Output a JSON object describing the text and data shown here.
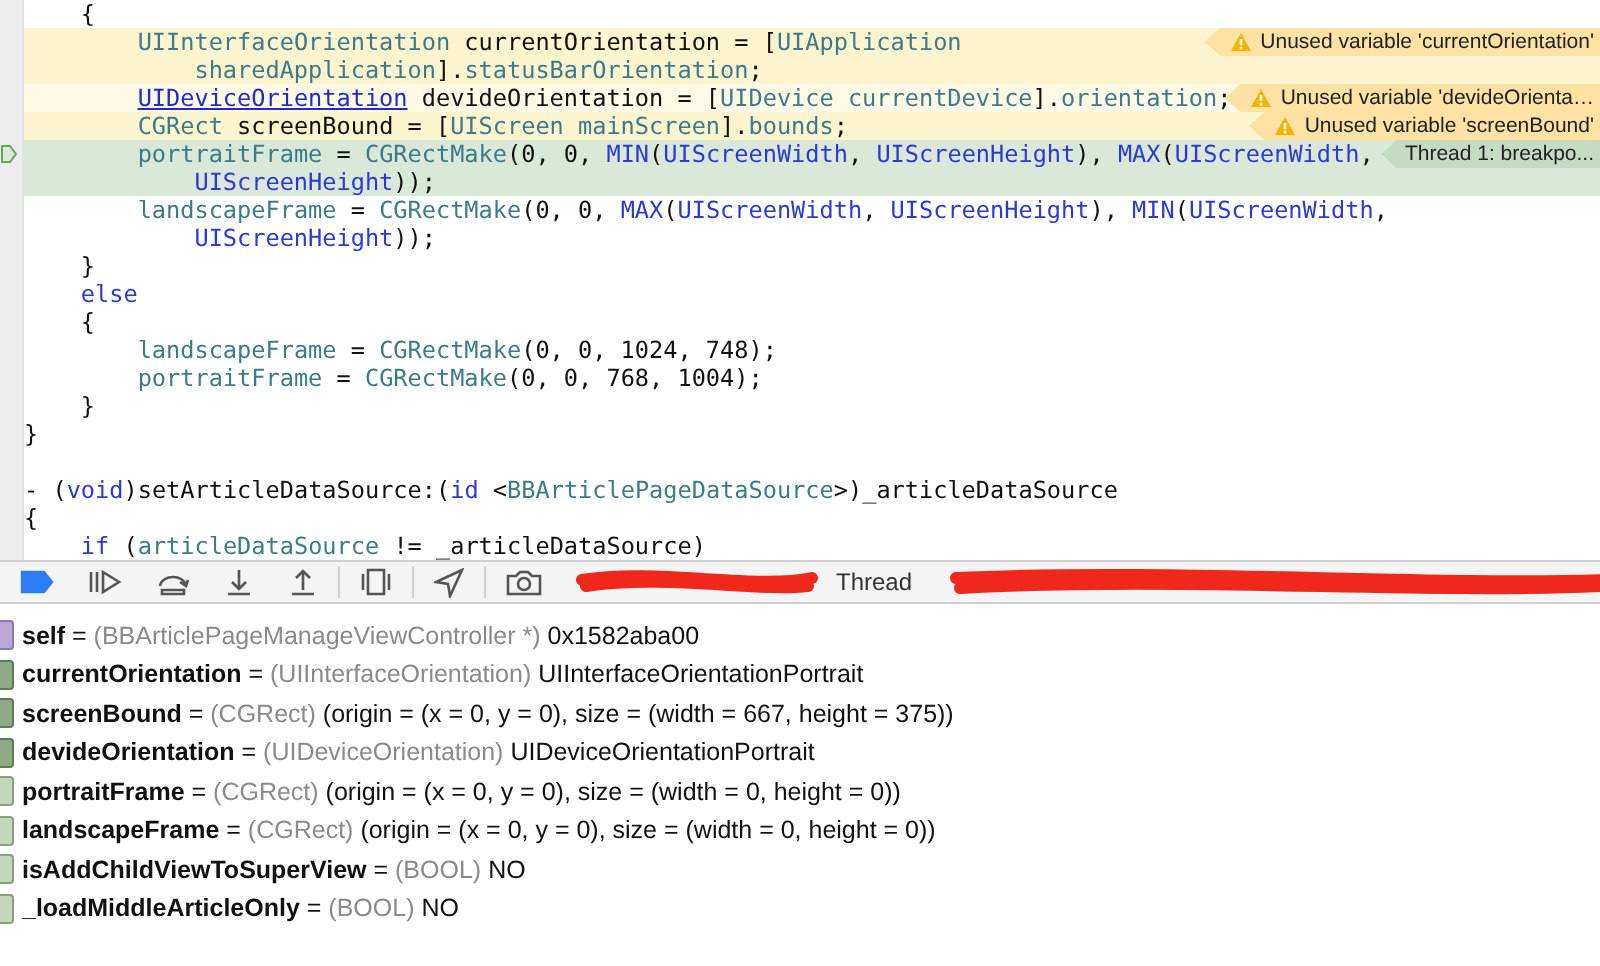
{
  "editor": {
    "lines": [
      {
        "children": [
          {
            "tokens": [
              {
                "kind": "plain",
                "text": "{"
              }
            ],
            "children": [
              {
                "warning": true,
                "tokens": [
                  {
                    "kind": "type",
                    "text": "UIInterfaceOrientation"
                  },
                  {
                    "kind": "plain",
                    "text": " currentOrientation = ["
                  },
                  {
                    "kind": "type",
                    "text": "UIApplication"
                  }
                ],
                "continuation": [
                  {
                    "kind": "type",
                    "text": "sharedApplication"
                  },
                  {
                    "kind": "plain",
                    "text": "]."
                  },
                  {
                    "kind": "type",
                    "text": "statusBarOrientation"
                  },
                  {
                    "kind": "plain",
                    "text": ";"
                  }
                ],
                "annotation": {
                  "kind": "warning",
                  "text": "Unused variable 'currentOrientation'"
                }
              },
              {
                "warning": true,
                "cursor_line": true,
                "tokens": [
                  {
                    "kind": "link",
                    "text": "UIDeviceOrientation"
                  },
                  {
                    "kind": "plain",
                    "text": " devideOrientation = ["
                  },
                  {
                    "kind": "type",
                    "text": "UIDevice currentDevice"
                  },
                  {
                    "kind": "plain",
                    "text": "]."
                  },
                  {
                    "kind": "type",
                    "text": "orientation"
                  },
                  {
                    "kind": "plain",
                    "text": ";"
                  }
                ],
                "annotation": {
                  "kind": "warning",
                  "text": "Unused variable 'devideOrienta…"
                }
              },
              {
                "warning": true,
                "tokens": [
                  {
                    "kind": "type",
                    "text": "CGRect"
                  },
                  {
                    "kind": "plain",
                    "text": " screenBound = ["
                  },
                  {
                    "kind": "type",
                    "text": "UIScreen mainScreen"
                  },
                  {
                    "kind": "plain",
                    "text": "]."
                  },
                  {
                    "kind": "type",
                    "text": "bounds"
                  },
                  {
                    "kind": "plain",
                    "text": ";"
                  }
                ],
                "annotation": {
                  "kind": "warning",
                  "text": "Unused variable 'screenBound'"
                }
              },
              {
                "stopped": true,
                "pc": true,
                "tokens": [
                  {
                    "kind": "type",
                    "text": "portraitFrame"
                  },
                  {
                    "kind": "plain",
                    "text": " = "
                  },
                  {
                    "kind": "type",
                    "text": "CGRectMake"
                  },
                  {
                    "kind": "plain",
                    "text": "(0, 0, "
                  },
                  {
                    "kind": "macro",
                    "text": "MIN"
                  },
                  {
                    "kind": "plain",
                    "text": "("
                  },
                  {
                    "kind": "macro",
                    "text": "UIScreenWidth"
                  },
                  {
                    "kind": "plain",
                    "text": ", "
                  },
                  {
                    "kind": "macro",
                    "text": "UIScreenHeight"
                  },
                  {
                    "kind": "plain",
                    "text": "), "
                  },
                  {
                    "kind": "macro",
                    "text": "MAX"
                  },
                  {
                    "kind": "plain",
                    "text": "("
                  },
                  {
                    "kind": "macro",
                    "text": "UIScreenWidth"
                  },
                  {
                    "kind": "plain",
                    "text": ","
                  }
                ],
                "continuation": [
                  {
                    "kind": "macro",
                    "text": "UIScreenHeight"
                  },
                  {
                    "kind": "plain",
                    "text": "));"
                  }
                ],
                "annotation": {
                  "kind": "thread",
                  "text": "Thread 1: breakpo..."
                }
              },
              {
                "tokens": [
                  {
                    "kind": "type",
                    "text": "landscapeFrame"
                  },
                  {
                    "kind": "plain",
                    "text": " = "
                  },
                  {
                    "kind": "type",
                    "text": "CGRectMake"
                  },
                  {
                    "kind": "plain",
                    "text": "(0, 0, "
                  },
                  {
                    "kind": "macro",
                    "text": "MAX"
                  },
                  {
                    "kind": "plain",
                    "text": "("
                  },
                  {
                    "kind": "macro",
                    "text": "UIScreenWidth"
                  },
                  {
                    "kind": "plain",
                    "text": ", "
                  },
                  {
                    "kind": "macro",
                    "text": "UIScreenHeight"
                  },
                  {
                    "kind": "plain",
                    "text": "), "
                  },
                  {
                    "kind": "macro",
                    "text": "MIN"
                  },
                  {
                    "kind": "plain",
                    "text": "("
                  },
                  {
                    "kind": "macro",
                    "text": "UIScreenWidth"
                  },
                  {
                    "kind": "plain",
                    "text": ","
                  }
                ],
                "continuation": [
                  {
                    "kind": "macro",
                    "text": "UIScreenHeight"
                  },
                  {
                    "kind": "plain",
                    "text": "));"
                  }
                ]
              }
            ]
          },
          {
            "tokens": [
              {
                "kind": "plain",
                "text": "}"
              }
            ]
          },
          {
            "tokens": [
              {
                "kind": "keyword",
                "text": "else"
              }
            ]
          },
          {
            "tokens": [
              {
                "kind": "plain",
                "text": "{"
              }
            ],
            "children": [
              {
                "tokens": [
                  {
                    "kind": "type",
                    "text": "landscapeFrame"
                  },
                  {
                    "kind": "plain",
                    "text": " = "
                  },
                  {
                    "kind": "type",
                    "text": "CGRectMake"
                  },
                  {
                    "kind": "plain",
                    "text": "(0, 0, 1024, 748);"
                  }
                ]
              },
              {
                "tokens": [
                  {
                    "kind": "type",
                    "text": "portraitFrame"
                  },
                  {
                    "kind": "plain",
                    "text": " = "
                  },
                  {
                    "kind": "type",
                    "text": "CGRectMake"
                  },
                  {
                    "kind": "plain",
                    "text": "(0, 0, 768, 1004);"
                  }
                ]
              }
            ]
          },
          {
            "tokens": [
              {
                "kind": "plain",
                "text": "}"
              }
            ]
          }
        ]
      },
      {
        "tokens": [
          {
            "kind": "plain",
            "text": "}"
          }
        ]
      },
      {
        "spaced": true,
        "tokens": [
          {
            "kind": "plain",
            "text": "- ("
          },
          {
            "kind": "keyword",
            "text": "void"
          },
          {
            "kind": "plain",
            "text": ")setArticleDataSource:("
          },
          {
            "kind": "keyword",
            "text": "id"
          },
          {
            "kind": "plain",
            "text": " <"
          },
          {
            "kind": "type",
            "text": "BBArticlePageDataSource"
          },
          {
            "kind": "plain",
            "text": ">)_articleDataSource"
          }
        ]
      },
      {
        "tokens": [
          {
            "kind": "plain",
            "text": "{"
          }
        ],
        "children": [
          {
            "tokens": [
              {
                "kind": "keyword",
                "text": "if"
              },
              {
                "kind": "plain",
                "text": " ("
              },
              {
                "kind": "type",
                "text": "articleDataSource"
              },
              {
                "kind": "plain",
                "text": " != _articleDataSource)"
              }
            ]
          }
        ]
      }
    ]
  },
  "debug_bar": {
    "breakpoints_active": true,
    "thread_label": "Thread"
  },
  "variables": [
    {
      "kind": "argument",
      "label": "**self** =",
      "type": "(BBArticlePageManageViewController *)",
      "value": "0x1582aba00"
    },
    {
      "kind": "local",
      "label": "**currentOrientation** =",
      "type": "(UIInterfaceOrientation)",
      "value": "UIInterfaceOrientationPortrait"
    },
    {
      "kind": "local",
      "label": "**screenBound** =",
      "type": "(CGRect)",
      "value": "(origin = (x = 0, y = 0), size = (width = 667, height = 375))"
    },
    {
      "kind": "local",
      "label": "**devideOrientation** =",
      "type": "(UIDeviceOrientation)",
      "value": "UIDeviceOrientationPortrait"
    },
    {
      "kind": "instance",
      "label": "**portraitFrame** =",
      "type": "(CGRect)",
      "value": "(origin = (x = 0, y = 0), size = (width = 0, height = 0))"
    },
    {
      "kind": "instance",
      "label": "**landscapeFrame** =",
      "type": "(CGRect)",
      "value": "(origin = (x = 0, y = 0), size = (width = 0, height = 0))"
    },
    {
      "kind": "instance",
      "label": "**isAddChildViewToSuperView** =",
      "type": "(BOOL)",
      "value": "NO"
    },
    {
      "kind": "instance",
      "label": "**_loadMiddleArticleOnly** =",
      "type": "(BOOL)",
      "value": "NO"
    }
  ]
}
